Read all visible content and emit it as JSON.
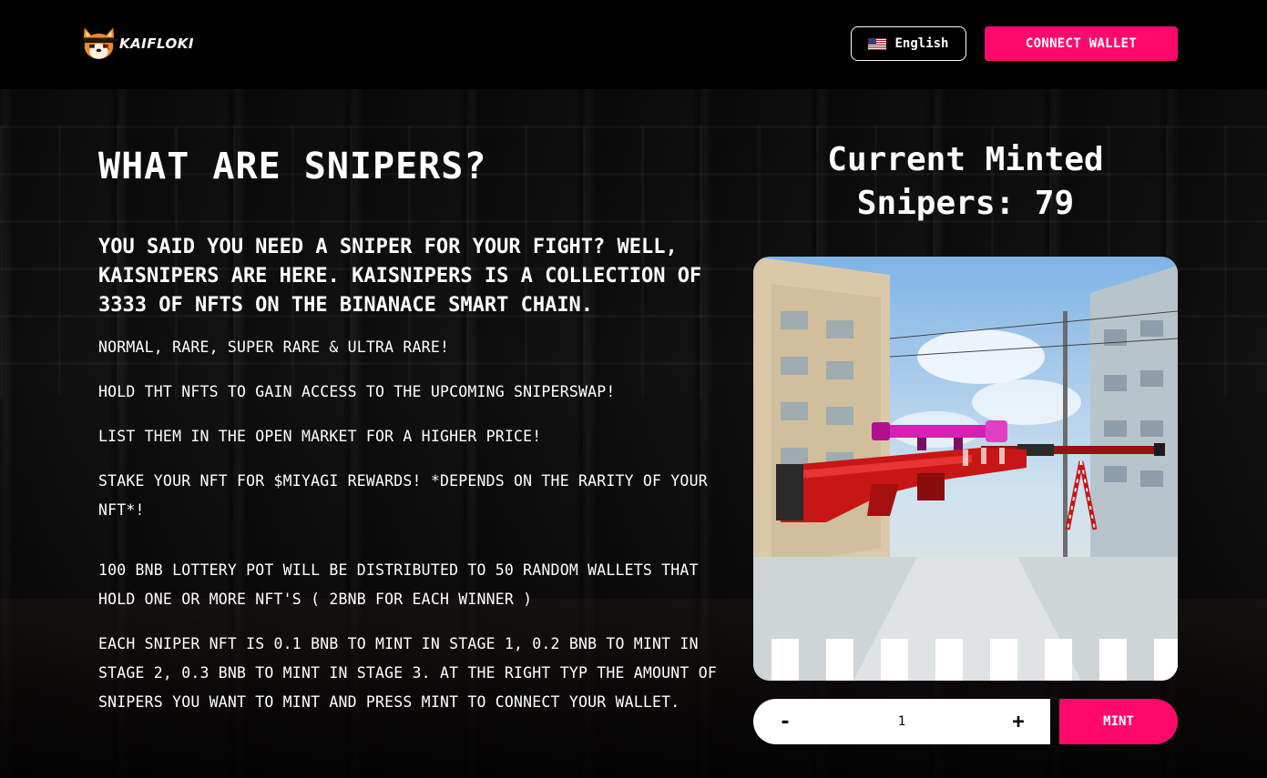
{
  "header": {
    "logo_text": "KAIFLOKI",
    "language_label": "English",
    "connect_label": "CONNECT WALLET"
  },
  "content": {
    "title": "WHAT ARE SNIPERS?",
    "lead": "YOU SAID YOU NEED A SNIPER FOR YOUR FIGHT? WELL, KAISNIPERS ARE HERE. KAISNIPERS IS A COLLECTION OF 3333 OF NFTS ON THE BINANACE SMART CHAIN.",
    "paragraphs": [
      "NORMAL, RARE, SUPER RARE & ULTRA RARE!",
      "HOLD THT NFTS TO GAIN ACCESS TO THE UPCOMING SNIPERSWAP!",
      "LIST THEM IN THE OPEN MARKET FOR A HIGHER PRICE!",
      "STAKE YOUR NFT FOR $MIYAGI REWARDS! *DEPENDS ON THE RARITY OF YOUR NFT*!",
      "100 BNB LOTTERY POT WILL BE DISTRIBUTED TO 50 RANDOM WALLETS THAT HOLD ONE OR MORE NFT'S ( 2BNB FOR EACH WINNER )",
      "EACH SNIPER NFT IS 0.1 BNB TO MINT IN STAGE 1, 0.2 BNB TO MINT IN STAGE 2, 0.3 BNB TO MINT IN STAGE 3. AT THE RIGHT TYP THE AMOUNT OF SNIPERS YOU WANT TO MINT AND PRESS MINT TO CONNECT YOUR WALLET."
    ]
  },
  "mint": {
    "minted_line1": "Current Minted",
    "minted_line2": "Snipers: 79",
    "decrement_label": "-",
    "increment_label": "+",
    "quantity_value": "1",
    "mint_label": "MINT"
  },
  "colors": {
    "accent": "#ff0a6c",
    "header_bg": "#000000"
  },
  "icons": {
    "logo": "shiba-inu-mascot-icon",
    "flag": "us-flag-icon"
  }
}
